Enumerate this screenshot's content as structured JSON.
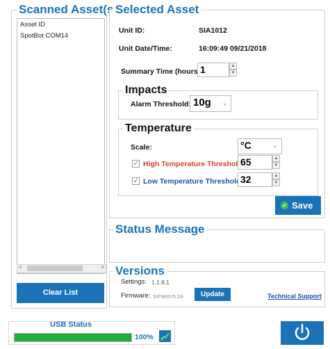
{
  "scanned": {
    "title": "Scanned Asset(s)",
    "column_header": "Asset ID",
    "items": [
      "SpotBot COM14"
    ],
    "clear_label": "Clear List"
  },
  "selected": {
    "title": "Selected Asset",
    "unit_id_label": "Unit ID:",
    "unit_id_value": "SIA1012",
    "date_label": "Unit Date/Time:",
    "date_value": "16:09:49 09/21/2018",
    "summary_label": "Summary Time (hours):",
    "summary_value": "1"
  },
  "impacts": {
    "title": "Impacts",
    "alarm_label": "Alarm Threshold:",
    "alarm_value": "10g"
  },
  "temperature": {
    "title": "Temperature",
    "scale_label": "Scale:",
    "scale_value": "°C",
    "high_label": "High Temperature Threshold:",
    "high_value": "65",
    "high_checked": true,
    "low_label": "Low Temperature Threshold:",
    "low_value": "32",
    "low_checked": true,
    "high_color": "#d9412e",
    "low_color": "#1f4fa8"
  },
  "save_label": "Save",
  "status": {
    "title": "Status Message"
  },
  "versions": {
    "title": "Versions",
    "settings_label": "Settings:",
    "settings_value": "1.1.8.1",
    "firmware_label": "Firmware:",
    "firmware_value": "SIFWRV5.24",
    "update_label": "Update",
    "support_label": "Technical Support"
  },
  "usb": {
    "title": "USB Status",
    "percent_text": "100%",
    "progress": 1.0
  },
  "colors": {
    "accent": "#1a73b8",
    "progress": "#1fad3a"
  }
}
